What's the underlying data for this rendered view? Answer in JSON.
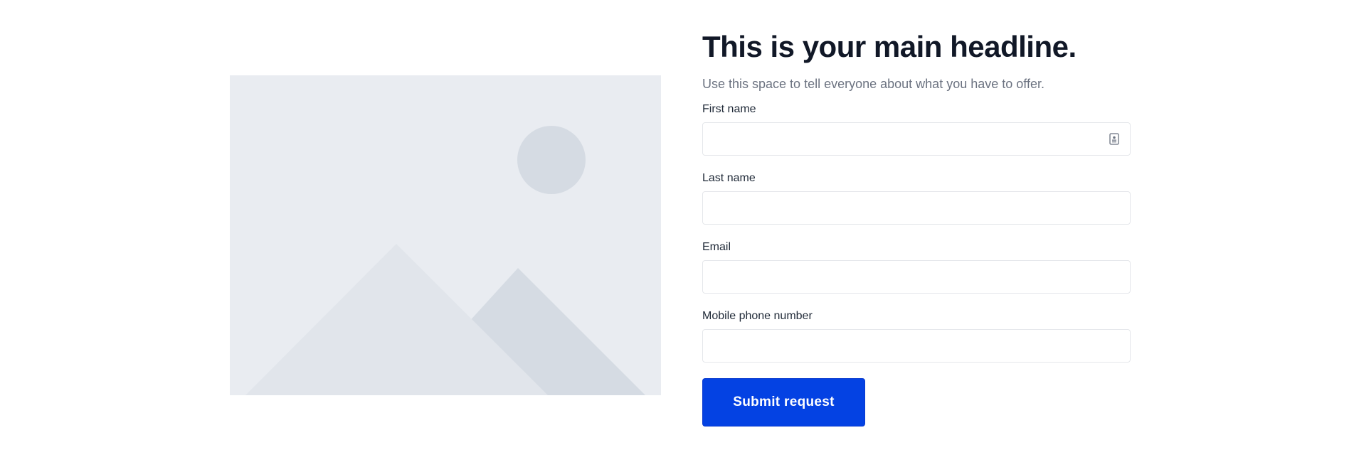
{
  "hero": {
    "headline": "This is your main headline.",
    "subtitle": "Use this space to tell everyone about what you have to offer.",
    "image": {
      "icon": "image-placeholder-icon",
      "colors": {
        "background": "#e9ecf1",
        "sun": "#d5dbe3",
        "mountain_front": "#e1e5eb",
        "mountain_back": "#d5dbe3"
      }
    }
  },
  "form": {
    "fields": [
      {
        "label": "First name",
        "value": "",
        "placeholder": ""
      },
      {
        "label": "Last name",
        "value": "",
        "placeholder": ""
      },
      {
        "label": "Email",
        "value": "",
        "placeholder": ""
      },
      {
        "label": "Mobile phone number",
        "value": "",
        "placeholder": ""
      }
    ],
    "autofill_icon": "contact-card-icon",
    "submit_label": "Submit request"
  },
  "colors": {
    "primary": "#0442e3",
    "heading": "#111827",
    "muted": "#6b7280",
    "border": "#e5e7eb"
  }
}
